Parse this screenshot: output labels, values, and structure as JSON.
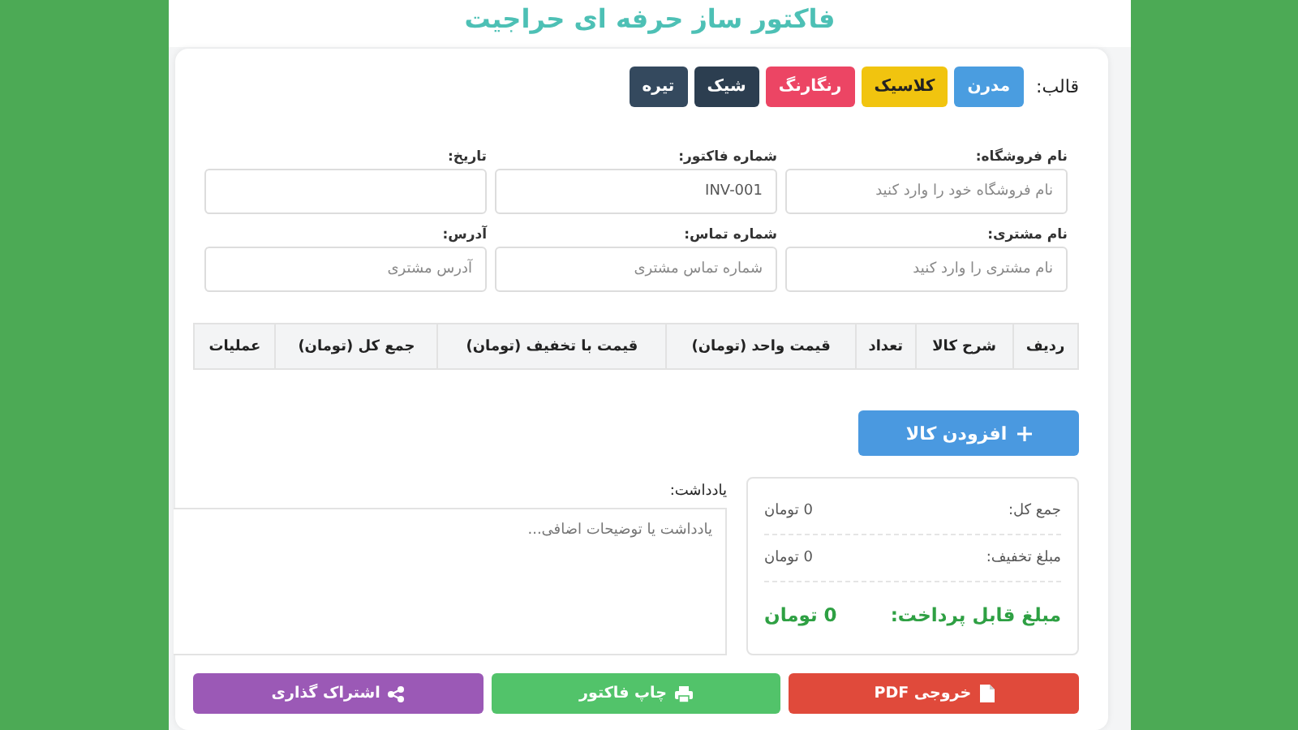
{
  "title": "فاکتور ساز حرفه ای حراجیت",
  "templates": {
    "label": "قالب:",
    "options": [
      {
        "label": "مدرن",
        "color": "#4a9de0"
      },
      {
        "label": "کلاسیک",
        "color": "#f1c40f"
      },
      {
        "label": "رنگارنگ",
        "color": "#ec4564"
      },
      {
        "label": "شیک",
        "color": "#2c3e50"
      },
      {
        "label": "تیره",
        "color": "#34495e"
      }
    ]
  },
  "fields": [
    {
      "label": "نام فروشگاه:",
      "placeholder": "نام فروشگاه خود را وارد کنید"
    },
    {
      "label": "شماره فاکتور:",
      "value": "INV-001"
    },
    {
      "label": "تاریخ:"
    },
    {
      "label": "نام مشتری:",
      "placeholder": "نام مشتری را وارد کنید"
    },
    {
      "label": "شماره تماس:",
      "placeholder": "شماره تماس مشتری"
    },
    {
      "label": "آدرس:",
      "placeholder": "آدرس مشتری"
    }
  ],
  "table": {
    "columns": [
      "ردیف",
      "شرح کالا",
      "تعداد",
      "قیمت واحد (تومان)",
      "قیمت با تخفیف (تومان)",
      "جمع کل (تومان)",
      "عملیات"
    ]
  },
  "add_button": "افزودن کالا",
  "summary": [
    {
      "kind": "normal",
      "label": "جمع کل:",
      "value": "0 تومان"
    },
    {
      "kind": "normal",
      "label": "مبلغ تخفیف:",
      "value": "0 تومان"
    },
    {
      "kind": "total",
      "label": "مبلغ قابل پرداخت:",
      "value": "0 تومان"
    }
  ],
  "note": {
    "label": "یادداشت:",
    "placeholder": "یادداشت یا توضیحات اضافی..."
  },
  "actions": [
    {
      "kind": "pdf",
      "label": "خروجی PDF"
    },
    {
      "kind": "print",
      "label": "چاپ فاکتور"
    },
    {
      "kind": "share",
      "label": "اشتراک گذاری"
    }
  ]
}
